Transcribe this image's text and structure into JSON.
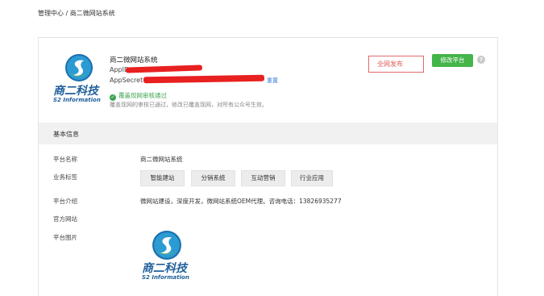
{
  "breadcrumb": {
    "root": "管理中心",
    "sep": " / ",
    "current": "商二微网站系统"
  },
  "header": {
    "system_name": "商二微网站系统",
    "appid_label": "AppID",
    "appid_value": "",
    "appsecret_label": "AppSecret",
    "appsecret_value": "",
    "reset_label": "重置",
    "audit_status": "覆盖现网审核通过",
    "audit_note": "覆盖现网的审核已通过，修改已覆盖现网，对所有公众号生效。",
    "publish_label": "全网发布",
    "modify_button": "修改平台",
    "help_glyph": "?"
  },
  "logo": {
    "name": "商二科技",
    "sub": "S2 Information"
  },
  "section": {
    "title": "基本信息"
  },
  "info": {
    "name_label": "平台名称",
    "name_value": "商二微网站系统",
    "tags_label": "业务标签",
    "tags": [
      "智能建站",
      "分销系统",
      "互动营销",
      "行业应用"
    ],
    "intro_label": "平台介绍",
    "intro_value": "微网站建设，深度开发，微网站系统OEM代理。咨询电话：13826935277",
    "website_label": "官方网站",
    "website_value": "",
    "image_label": "平台图片"
  },
  "colors": {
    "brand_blue": "#1f5f9b",
    "green": "#44b549",
    "redaction": "#e82020",
    "link": "#3a7bd5"
  }
}
